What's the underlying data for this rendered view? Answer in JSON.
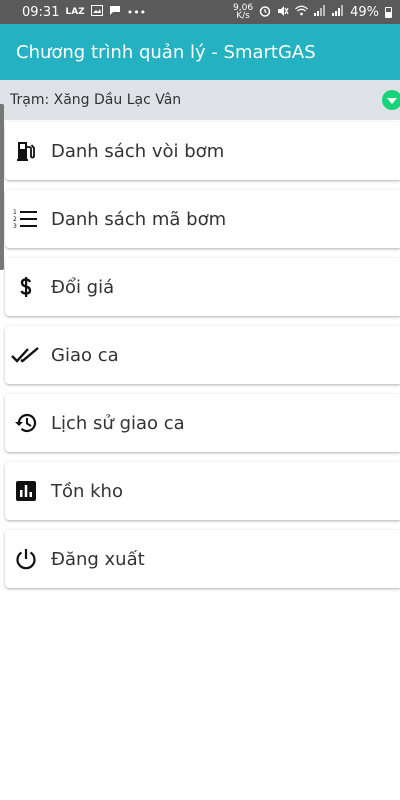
{
  "statusbar": {
    "time": "09:31",
    "app_badge": "LAZ",
    "net_speed_top": "9,06",
    "net_speed_bottom": "K/s",
    "battery": "49%"
  },
  "appbar": {
    "title": "Chương trình quản lý - SmartGAS"
  },
  "station": {
    "label": "Trạm: Xăng Dầu Lạc Vân"
  },
  "menu": {
    "items": [
      {
        "label": "Danh sách vòi bơm",
        "icon": "fuel-pump-icon"
      },
      {
        "label": "Danh sách mã bơm",
        "icon": "numbered-list-icon"
      },
      {
        "label": "Đổi giá",
        "icon": "dollar-icon"
      },
      {
        "label": "Giao ca",
        "icon": "double-check-icon"
      },
      {
        "label": "Lịch sử giao ca",
        "icon": "history-icon"
      },
      {
        "label": "Tồn kho",
        "icon": "bar-chart-icon"
      },
      {
        "label": "Đăng xuất",
        "icon": "power-icon"
      }
    ]
  },
  "colors": {
    "primary": "#24b2c2",
    "accent_green": "#17d37a",
    "station_bg": "#dfe2e6",
    "statusbar": "#5a5a5a"
  }
}
